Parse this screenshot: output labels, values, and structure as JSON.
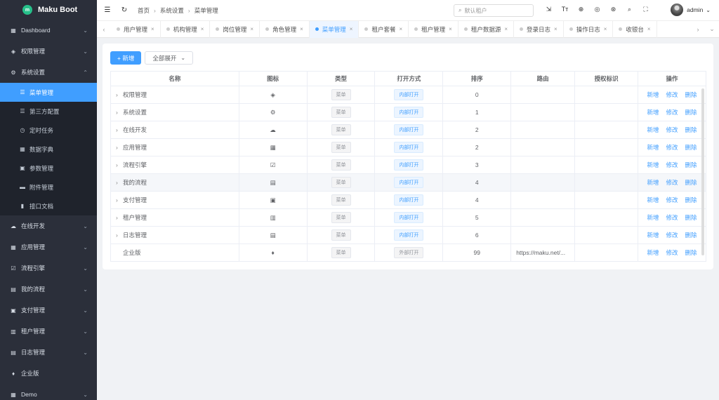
{
  "app": {
    "title": "Maku Boot",
    "logo_text": "m"
  },
  "sidebar": {
    "items": [
      {
        "label": "Dashboard",
        "icon": "▦",
        "chevron": "⌄"
      },
      {
        "label": "权限管理",
        "icon": "◈",
        "chevron": "⌄"
      },
      {
        "label": "系统设置",
        "icon": "⚙",
        "chevron": "⌃"
      },
      {
        "label": "在线开发",
        "icon": "☁",
        "chevron": "⌄"
      },
      {
        "label": "应用管理",
        "icon": "▦",
        "chevron": "⌄"
      },
      {
        "label": "流程引擎",
        "icon": "☑",
        "chevron": "⌄"
      },
      {
        "label": "我的流程",
        "icon": "▤",
        "chevron": "⌄"
      },
      {
        "label": "支付管理",
        "icon": "▣",
        "chevron": "⌄"
      },
      {
        "label": "租户管理",
        "icon": "▥",
        "chevron": "⌄"
      },
      {
        "label": "日志管理",
        "icon": "▤",
        "chevron": "⌄"
      },
      {
        "label": "企业版",
        "icon": "♦",
        "chevron": ""
      },
      {
        "label": "Demo",
        "icon": "▦",
        "chevron": "⌄"
      }
    ],
    "submenu": [
      {
        "label": "菜单管理",
        "icon": "☰"
      },
      {
        "label": "第三方配置",
        "icon": "☰"
      },
      {
        "label": "定时任务",
        "icon": "◷"
      },
      {
        "label": "数据字典",
        "icon": "▦"
      },
      {
        "label": "参数管理",
        "icon": "▣"
      },
      {
        "label": "附件管理",
        "icon": "▬"
      },
      {
        "label": "接口文档",
        "icon": "▮"
      }
    ]
  },
  "header": {
    "breadcrumb": [
      "首页",
      "系统设置",
      "菜单管理"
    ],
    "search_placeholder": "默认租户",
    "user_name": "admin",
    "icons": {
      "fold": "☰",
      "refresh": "↻",
      "user_menu_chevron": "⌄"
    },
    "tools": [
      "⇲",
      "Tт",
      "⊕",
      "◎",
      "⊛",
      "⌕",
      "⛶"
    ]
  },
  "tabs": {
    "items": [
      "用户管理",
      "机构管理",
      "岗位管理",
      "角色管理",
      "菜单管理",
      "租户套餐",
      "租户管理",
      "租户数据源",
      "登录日志",
      "操作日志",
      "收银台"
    ],
    "active_index": 4,
    "close_glyph": "×",
    "arrows": [
      "‹",
      "›",
      "⌄"
    ]
  },
  "toolbar": {
    "add_label": "+ 新增",
    "expand_label": "全部展开",
    "expand_chevron": "⌄"
  },
  "table": {
    "headers": [
      "名称",
      "图标",
      "类型",
      "打开方式",
      "排序",
      "路由",
      "授权标识",
      "操作"
    ],
    "rows": [
      {
        "name": "权限管理",
        "expand": "›",
        "icon": "◈",
        "type": "菜单",
        "open": "内部打开",
        "sort": "0",
        "route": "",
        "perm": ""
      },
      {
        "name": "系统设置",
        "expand": "›",
        "icon": "⚙",
        "type": "菜单",
        "open": "内部打开",
        "sort": "1",
        "route": "",
        "perm": ""
      },
      {
        "name": "在线开发",
        "expand": "›",
        "icon": "☁",
        "type": "菜单",
        "open": "内部打开",
        "sort": "2",
        "route": "",
        "perm": ""
      },
      {
        "name": "应用管理",
        "expand": "›",
        "icon": "▦",
        "type": "菜单",
        "open": "内部打开",
        "sort": "2",
        "route": "",
        "perm": ""
      },
      {
        "name": "流程引擎",
        "expand": "›",
        "icon": "☑",
        "type": "菜单",
        "open": "内部打开",
        "sort": "3",
        "route": "",
        "perm": ""
      },
      {
        "name": "我的流程",
        "expand": "›",
        "icon": "▤",
        "type": "菜单",
        "open": "内部打开",
        "sort": "4",
        "route": "",
        "perm": ""
      },
      {
        "name": "支付管理",
        "expand": "›",
        "icon": "▣",
        "type": "菜单",
        "open": "内部打开",
        "sort": "4",
        "route": "",
        "perm": ""
      },
      {
        "name": "租户管理",
        "expand": "›",
        "icon": "▥",
        "type": "菜单",
        "open": "内部打开",
        "sort": "5",
        "route": "",
        "perm": ""
      },
      {
        "name": "日志管理",
        "expand": "›",
        "icon": "▤",
        "type": "菜单",
        "open": "内部打开",
        "sort": "6",
        "route": "",
        "perm": ""
      },
      {
        "name": "企业版",
        "expand": "",
        "icon": "♦",
        "type": "菜单",
        "open": "外部打开",
        "sort": "99",
        "route": "https://maku.net/...",
        "perm": ""
      }
    ],
    "actions": [
      "新增",
      "修改",
      "删除"
    ],
    "highlighted_row": 5
  },
  "colors": {
    "primary": "#409eff",
    "sidebar_bg": "#2b2f3a",
    "logo": "#27c08a"
  }
}
